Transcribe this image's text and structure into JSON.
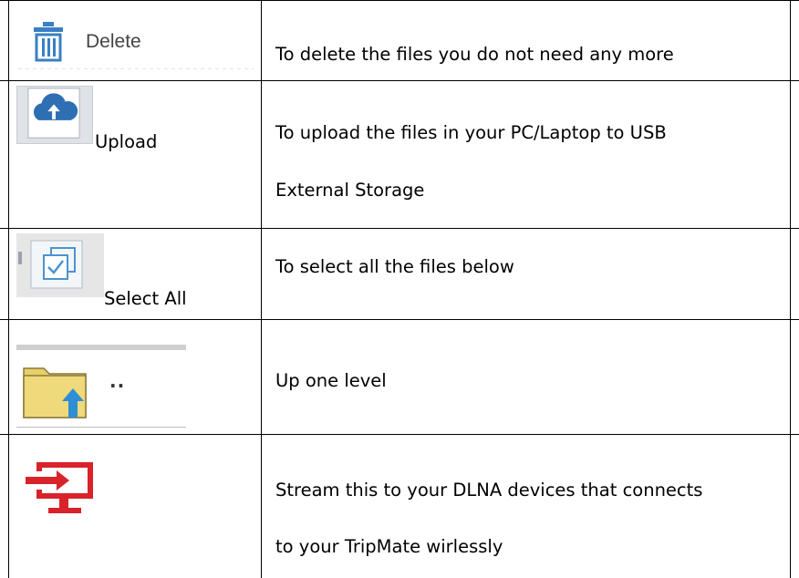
{
  "rows": [
    {
      "icon": "trash-icon",
      "label": "Delete",
      "description": [
        "To delete the files you do not need any more"
      ]
    },
    {
      "icon": "cloud-upload-icon",
      "label": "Upload",
      "description": [
        "To upload the files in your PC/Laptop to USB",
        "External Storage"
      ]
    },
    {
      "icon": "select-all-checkbox-icon",
      "label": "Select All",
      "description": [
        "To select all the files below"
      ]
    },
    {
      "icon": "folder-up-icon",
      "label": "..",
      "description": [
        "Up one level"
      ]
    },
    {
      "icon": "stream-to-monitor-icon",
      "label": "",
      "description": [
        "Stream this to your DLNA devices that connects",
        "to your TripMate wirlessly"
      ]
    }
  ],
  "colors": {
    "trash_icon": "#3a7fc4",
    "upload_icon": "#2e6fb3",
    "folder_icon": "#e7cf6a",
    "up_arrow": "#2e8fd6",
    "stream_icon": "#d8232a"
  }
}
